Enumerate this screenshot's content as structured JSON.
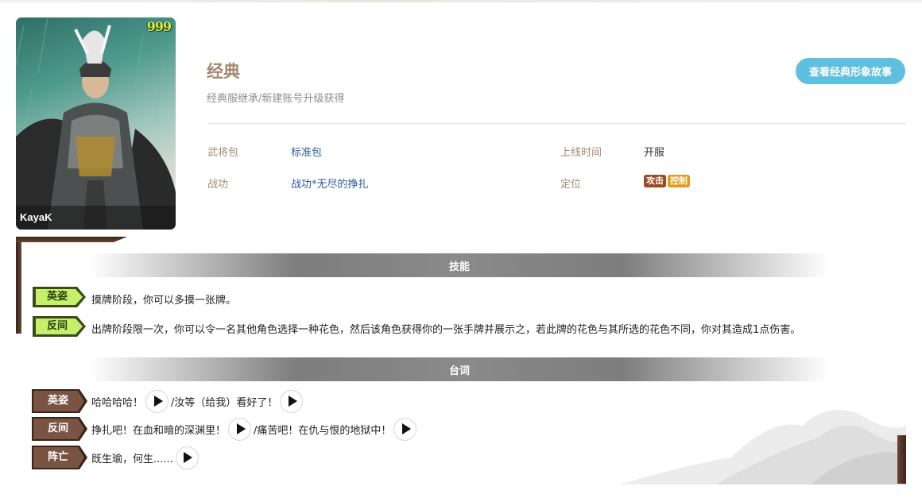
{
  "portrait": {
    "rating": "999",
    "artist": "KayaK"
  },
  "header": {
    "title": "经典",
    "subtitle": "经典服继承/新建账号升级获得",
    "story_button": "查看经典形象故事"
  },
  "info": {
    "package_label": "武将包",
    "package_value": "标准包",
    "merit_label": "战功",
    "merit_value": "战功*无尽的挣扎",
    "online_label": "上线时间",
    "online_value": "开服",
    "role_label": "定位",
    "role_tags": [
      "攻击",
      "控制"
    ]
  },
  "skills_section": {
    "title": "技能",
    "items": [
      {
        "name": "英姿",
        "desc": "摸牌阶段，你可以多摸一张牌。"
      },
      {
        "name": "反间",
        "desc": "出牌阶段限一次，你可以令一名其他角色选择一种花色，然后该角色获得你的一张手牌并展示之，若此牌的花色与其所选的花色不同，你对其造成1点伤害。"
      }
    ]
  },
  "quotes_section": {
    "title": "台词",
    "items": [
      {
        "name": "英姿",
        "line1": "哈哈哈哈！",
        "line2": "/汝等（给我）看好了！"
      },
      {
        "name": "反间",
        "line1": "挣扎吧！在血和暗的深渊里！",
        "line2": "/痛苦吧！在仇与恨的地狱中！"
      },
      {
        "name": "阵亡",
        "line1": "既生瑜，何生......"
      }
    ]
  },
  "colors": {
    "accent": "#5ebfdf",
    "label": "#a28a70",
    "link": "#2e5b9a",
    "attack": "#9a4a22",
    "control": "#e29a17"
  }
}
